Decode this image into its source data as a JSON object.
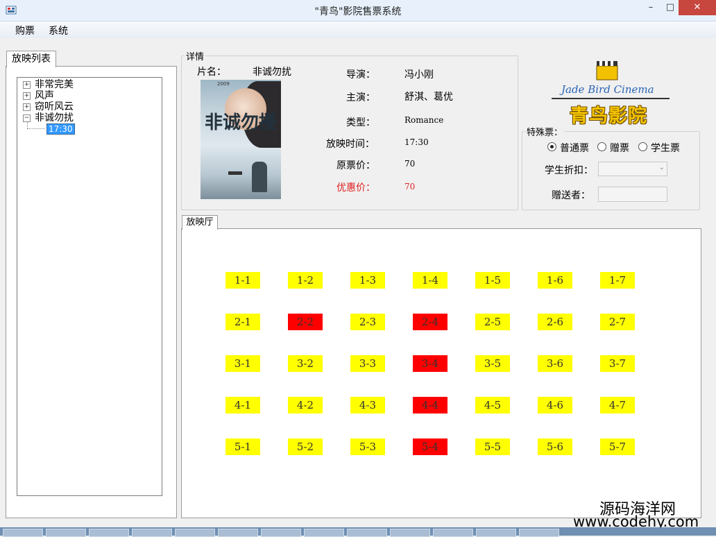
{
  "window": {
    "title": "\"青鸟\"影院售票系统"
  },
  "menu": [
    {
      "label": "购票"
    },
    {
      "label": "系统"
    }
  ],
  "left": {
    "tab": "放映列表",
    "movies": [
      {
        "label": "非常完美"
      },
      {
        "label": "风声"
      },
      {
        "label": "窃听风云"
      },
      {
        "label": "非诚勿扰"
      }
    ],
    "selected_time": "17:30"
  },
  "details": {
    "legend": "详情",
    "name_label": "片名：",
    "name_value": "非诚勿扰",
    "director_label": "导演：",
    "director_value": "冯小刚",
    "actor_label": "主演：",
    "actor_value": "舒淇、葛优",
    "type_label": "类型：",
    "type_value": "Romance",
    "time_label": "放映时间：",
    "time_value": "17:30",
    "price_label": "原票价：",
    "price_value": "70",
    "discount_label": "优惠价：",
    "discount_value": "70",
    "poster": {
      "title": "非诚勿擾",
      "year": "2009"
    }
  },
  "logo": {
    "en": "Jade Bird Cinema",
    "cn": "青鸟影院"
  },
  "special": {
    "legend": "特殊票：",
    "options": [
      {
        "label": "普通票",
        "checked": true
      },
      {
        "label": "赠票",
        "checked": false
      },
      {
        "label": "学生票",
        "checked": false
      }
    ],
    "student_label": "学生折扣：",
    "student_value": "",
    "giver_label": "赠送者：",
    "giver_value": ""
  },
  "hall": {
    "tab": "放映厅",
    "rows": [
      [
        {
          "label": "1-1",
          "sold": false
        },
        {
          "label": "1-2",
          "sold": false
        },
        {
          "label": "1-3",
          "sold": false
        },
        {
          "label": "1-4",
          "sold": false
        },
        {
          "label": "1-5",
          "sold": false
        },
        {
          "label": "1-6",
          "sold": false
        },
        {
          "label": "1-7",
          "sold": false
        }
      ],
      [
        {
          "label": "2-1",
          "sold": false
        },
        {
          "label": "2-2",
          "sold": true
        },
        {
          "label": "2-3",
          "sold": false
        },
        {
          "label": "2-4",
          "sold": true
        },
        {
          "label": "2-5",
          "sold": false
        },
        {
          "label": "2-6",
          "sold": false
        },
        {
          "label": "2-7",
          "sold": false
        }
      ],
      [
        {
          "label": "3-1",
          "sold": false
        },
        {
          "label": "3-2",
          "sold": false
        },
        {
          "label": "3-3",
          "sold": false
        },
        {
          "label": "3-4",
          "sold": true
        },
        {
          "label": "3-5",
          "sold": false
        },
        {
          "label": "3-6",
          "sold": false
        },
        {
          "label": "3-7",
          "sold": false
        }
      ],
      [
        {
          "label": "4-1",
          "sold": false
        },
        {
          "label": "4-2",
          "sold": false
        },
        {
          "label": "4-3",
          "sold": false
        },
        {
          "label": "4-4",
          "sold": true
        },
        {
          "label": "4-5",
          "sold": false
        },
        {
          "label": "4-6",
          "sold": false
        },
        {
          "label": "4-7",
          "sold": false
        }
      ],
      [
        {
          "label": "5-1",
          "sold": false
        },
        {
          "label": "5-2",
          "sold": false
        },
        {
          "label": "5-3",
          "sold": false
        },
        {
          "label": "5-4",
          "sold": true
        },
        {
          "label": "5-5",
          "sold": false
        },
        {
          "label": "5-6",
          "sold": false
        },
        {
          "label": "5-7",
          "sold": false
        }
      ]
    ]
  },
  "watermark": {
    "cn": "源码海洋网",
    "url": "www.codehy.com"
  },
  "colors": {
    "free_seat": "#ffff00",
    "sold_seat": "#ff0000",
    "discount_text": "#e02020"
  }
}
